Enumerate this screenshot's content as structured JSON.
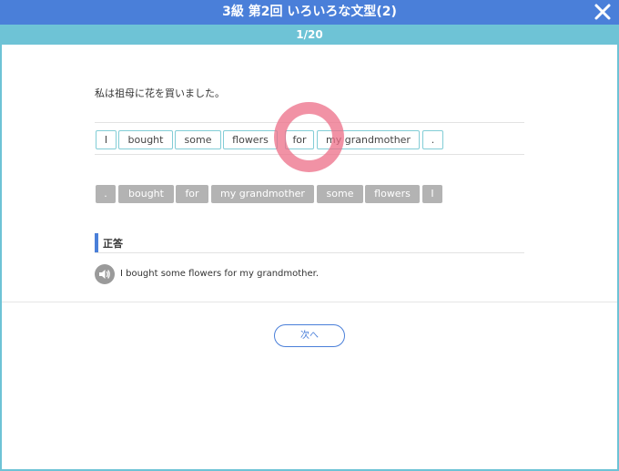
{
  "header": {
    "title": "3級 第2回 いろいろな文型(2)",
    "progress": "1/20"
  },
  "question": {
    "prompt": "私は祖母に花を買いました。"
  },
  "answer_tiles": [
    "I",
    "bought",
    "some",
    "flowers",
    "for",
    "my grandmother",
    "."
  ],
  "pool_tiles": [
    ".",
    "bought",
    "for",
    "my grandmother",
    "some",
    "flowers",
    "I"
  ],
  "correct": {
    "label": "正答",
    "sentence": "I bought some flowers for my grandmother."
  },
  "footer": {
    "next_label": "次へ"
  },
  "colors": {
    "title_bar": "#4a7fd9",
    "counter_bar": "#6ec3d6",
    "tile_border": "#82cdd6",
    "pool_tile": "#b3b3b3",
    "tap_indicator": "#ec6d87"
  },
  "icons": {
    "close": "close-icon",
    "speaker": "speaker-icon"
  }
}
